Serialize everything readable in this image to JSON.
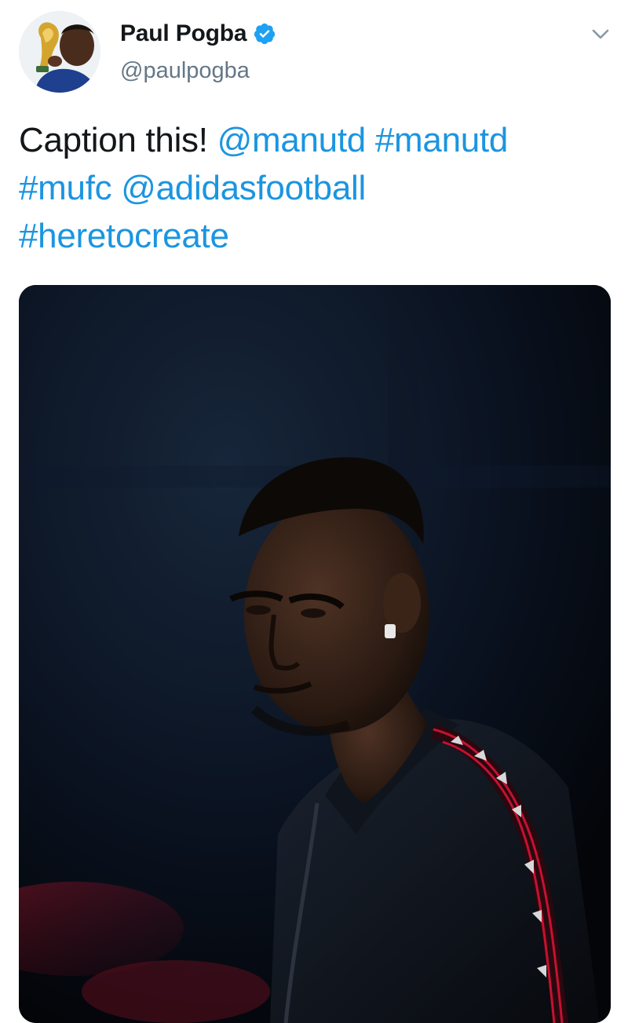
{
  "tweet": {
    "author": {
      "display_name": "Paul Pogba",
      "handle": "@paulpogba",
      "verified": true,
      "verified_color": "#1da1f2"
    },
    "text_parts": {
      "lead": "Caption this!",
      "mention_1": "@manutd",
      "hashtag_1": "#manutd",
      "hashtag_2": "#mufc",
      "mention_2": "@adidasfootball",
      "hashtag_3": "#heretocreate"
    },
    "link_color": "#1b95e0",
    "media": {
      "type": "photo"
    },
    "icons": {
      "menu": "chevron-down-icon",
      "verified": "verified-badge-icon"
    }
  }
}
